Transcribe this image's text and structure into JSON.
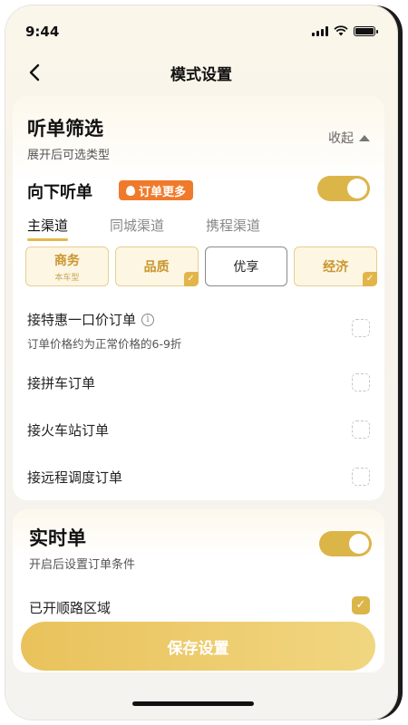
{
  "status_bar": {
    "time": "9:44",
    "icons": [
      "signal-icon",
      "wifi-icon",
      "battery-icon"
    ]
  },
  "nav": {
    "title": "模式设置",
    "back_icon": "chevron-left-icon"
  },
  "filter_section": {
    "title": "听单筛选",
    "subtitle": "展开后可选类型",
    "collapse_label": "收起",
    "listen_down": {
      "label": "向下听单",
      "badge": "订单更多",
      "toggle_on": true
    },
    "tabs": [
      {
        "label": "主渠道",
        "active": true
      },
      {
        "label": "同城渠道",
        "active": false
      },
      {
        "label": "携程渠道",
        "active": false
      }
    ],
    "options": [
      {
        "label": "商务",
        "sub": "本车型",
        "selected": true,
        "checked": false
      },
      {
        "label": "品质",
        "sub": "",
        "selected": true,
        "checked": true
      },
      {
        "label": "优享",
        "sub": "",
        "selected": false,
        "checked": false
      },
      {
        "label": "经济",
        "sub": "",
        "selected": true,
        "checked": true
      }
    ],
    "items": [
      {
        "label": "接特惠一口价订单",
        "sub": "订单价格约为正常价格的6-9折",
        "checked": false
      },
      {
        "label": "接拼车订单",
        "checked": false
      },
      {
        "label": "接火车站订单",
        "checked": false
      },
      {
        "label": "接远程调度订单",
        "checked": false
      }
    ]
  },
  "realtime_section": {
    "title": "实时单",
    "subtitle": "开启后设置订单条件",
    "toggle_on": true,
    "route_label": "已开顺路区域",
    "route_checked": true
  },
  "save_button": {
    "label": "保存设置"
  },
  "colors": {
    "accent": "#dcb548",
    "badge": "#f07a2b",
    "button": "#e9c25b"
  }
}
